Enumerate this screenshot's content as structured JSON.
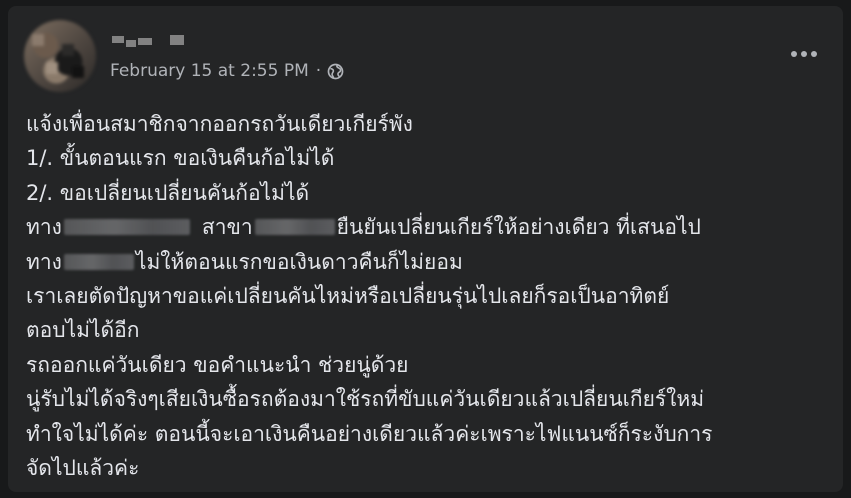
{
  "post": {
    "author": "",
    "timestamp": "February 15 at 2:55 PM",
    "separator": "·",
    "privacy_icon": "globe-icon",
    "more_icon": "more-horizontal-icon",
    "lines": [
      "แจ้งเพื่อนสมาชิกจากออกรถวันเดียวเกียร์พัง",
      "1/. ขั้นตอนแรก  ขอเงินคืนก้อไม่ได้",
      "2/. ขอเปลี่ยนเปลี่ยนคันก้อไม่ได้",
      {
        "a": "ทาง",
        "b": "สาขา",
        "c": "ยืนยันเปลี่ยนเกียร์ให้อย่างเดียว ที่เสนอไป"
      },
      {
        "a": "ทาง",
        "b": "ไม่ให้ตอนแรกขอเงินดาวคืนก็ไม่ยอม"
      },
      "เราเลยตัดปัญหาขอแค่เปลี่ยนคันไหม่หรือเปลี่ยนรุ่นไปเลยก็รอเป็นอาทิตย์",
      "ตอบไม่ได้อีก",
      "รถออกแค่วันเดียว ขอคำแนะนำ ช่วยนู่ด้วย",
      "นู่รับไม่ได้จริงๆเสียเงินซื้อรถต้องมาใช้รถที่ขับแค่วันเดียวแล้วเปลี่ยนเกียร์ใหม่",
      "ทำใจไม่ได้ค่ะ ตอนนี้จะเอาเงินคืนอย่างเดียวแล้วค่ะเพราะไฟแนนซ์ก็ระงับการ",
      "จัดไปแล้วค่ะ"
    ]
  }
}
